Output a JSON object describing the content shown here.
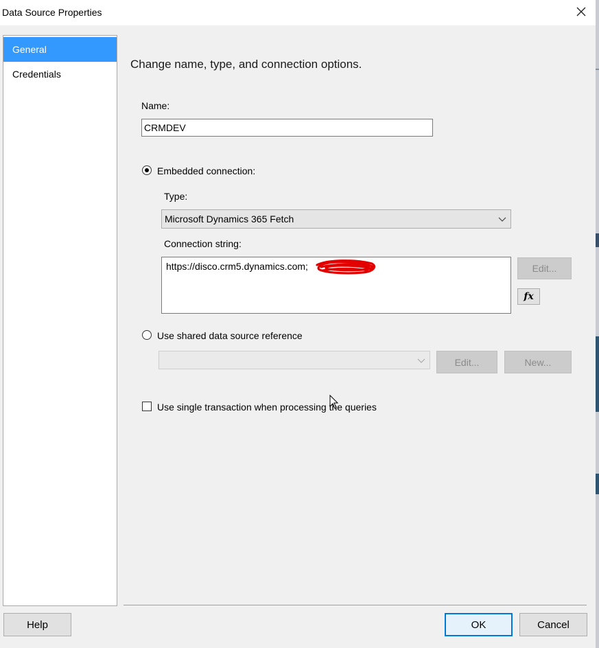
{
  "window": {
    "title": "Data Source Properties",
    "close_icon": "close-icon"
  },
  "sidebar": {
    "items": [
      {
        "label": "General",
        "selected": true
      },
      {
        "label": "Credentials",
        "selected": false
      }
    ]
  },
  "main": {
    "heading": "Change name, type, and connection options.",
    "name_label": "Name:",
    "name_value": "CRMDEV",
    "embedded_label": "Embedded connection:",
    "embedded_selected": true,
    "type_label": "Type:",
    "type_value": "Microsoft Dynamics 365 Fetch",
    "connstr_label": "Connection string:",
    "connstr_value": "https://disco.crm5.dynamics.com;",
    "connstr_edit_label": "Edit...",
    "fx_label": "fx",
    "shared_label": "Use shared data source reference",
    "shared_selected": false,
    "shared_edit_label": "Edit...",
    "shared_new_label": "New...",
    "single_txn_label": "Use single transaction when processing the queries",
    "single_txn_checked": false
  },
  "footer": {
    "help_label": "Help",
    "ok_label": "OK",
    "cancel_label": "Cancel"
  },
  "colors": {
    "selection": "#3399ff",
    "background": "#f0f0f0"
  }
}
